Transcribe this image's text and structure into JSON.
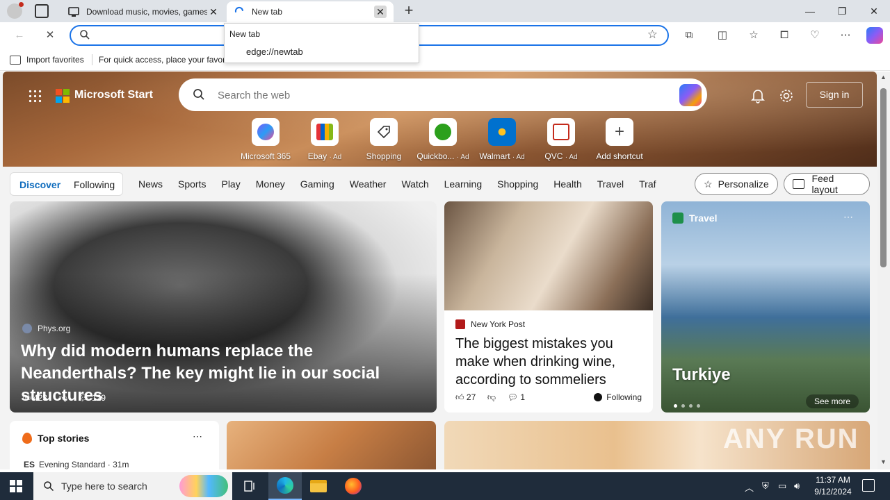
{
  "browser": {
    "tabs": [
      {
        "title": "Download music, movies, games"
      },
      {
        "title": "New tab"
      }
    ],
    "address": {
      "value": "",
      "placeholder": ""
    },
    "suggestion": {
      "header": "New tab",
      "item": "edge://newtab"
    },
    "favorites_bar": {
      "import_label": "Import favorites",
      "hint": "For quick access, place your favorites here on the favorites bar."
    }
  },
  "page": {
    "brand": "Microsoft Start",
    "search_placeholder": "Search the web",
    "signin_label": "Sign in",
    "shortcuts": [
      {
        "label": "Microsoft 365",
        "ad": "",
        "color": "#7b5cf5"
      },
      {
        "label": "Ebay",
        "ad": "· Ad",
        "color": "#e53238"
      },
      {
        "label": "Shopping",
        "ad": "",
        "color": "#333333"
      },
      {
        "label": "Quickbo...",
        "ad": "· Ad",
        "color": "#2ca01c"
      },
      {
        "label": "Walmart",
        "ad": "· Ad",
        "color": "#0071ce"
      },
      {
        "label": "QVC",
        "ad": "· Ad",
        "color": "#c42b1c"
      },
      {
        "label": "Add shortcut",
        "ad": "",
        "color": "#444444"
      }
    ],
    "feed_tabs": {
      "discover": "Discover",
      "following": "Following"
    },
    "categories": [
      "News",
      "Sports",
      "Play",
      "Money",
      "Gaming",
      "Weather",
      "Watch",
      "Learning",
      "Shopping",
      "Health",
      "Travel",
      "Traf"
    ],
    "personalize_label": "Personalize",
    "feed_layout_label": "Feed layout",
    "card_main": {
      "source": "Phys.org",
      "headline": "Why did modern humans replace the Neanderthals? The key might lie in our social structures",
      "likes": "423",
      "comments": "129"
    },
    "card_wine": {
      "source": "New York Post",
      "headline": "The biggest mistakes you make when drinking wine, according to sommeliers",
      "likes": "27",
      "comments": "1",
      "following": "Following"
    },
    "card_travel": {
      "category": "Travel",
      "place": "Turkiye",
      "see_more": "See more"
    },
    "top_stories": {
      "title": "Top stories",
      "source": "Evening Standard",
      "time": "· 31m"
    },
    "watermark": "ANY RUN"
  },
  "taskbar": {
    "search_placeholder": "Type here to search",
    "time": "11:37 AM",
    "date": "9/12/2024"
  },
  "colors": {
    "accent": "#1a73e8",
    "link": "#0f6cbd"
  }
}
